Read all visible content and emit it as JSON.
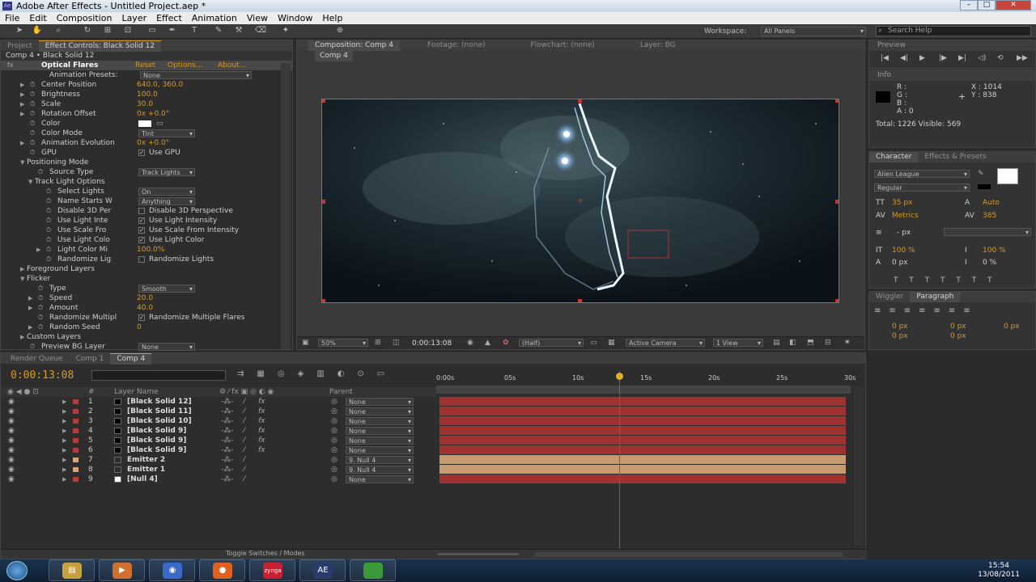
{
  "app": {
    "title": "Adobe After Effects - Untitled Project.aep *",
    "icon": "ae-icon"
  },
  "window_controls": {
    "minimize": "–",
    "maximize": "□",
    "close": "✕"
  },
  "menu": [
    "File",
    "Edit",
    "Composition",
    "Layer",
    "Effect",
    "Animation",
    "View",
    "Window",
    "Help"
  ],
  "toolbar": {
    "workspace_label": "Workspace:",
    "workspace_value": "All Panels",
    "search_placeholder": "Search Help"
  },
  "left_panel": {
    "tabs": [
      "Project",
      "Effect Controls: Black Solid 12"
    ],
    "breadcrumb": "Comp 4 • Black Solid 12",
    "effect_name": "Optical Flares",
    "reset": "Reset",
    "options": "Options...",
    "about": "About...",
    "props": [
      {
        "label": "Animation Presets:",
        "value": "None",
        "kind": "dd"
      },
      {
        "label": "Center Position",
        "value": "640.0, 360.0",
        "kind": "val"
      },
      {
        "label": "Brightness",
        "value": "100.0",
        "kind": "val"
      },
      {
        "label": "Scale",
        "value": "30.0",
        "kind": "val"
      },
      {
        "label": "Rotation Offset",
        "value": "0x +0.0°",
        "kind": "val"
      },
      {
        "label": "Color",
        "value": "",
        "kind": "color"
      },
      {
        "label": "Color Mode",
        "value": "Tint",
        "kind": "dd"
      },
      {
        "label": "Animation Evolution",
        "value": "0x +0.0°",
        "kind": "val"
      },
      {
        "label": "GPU",
        "value": "Use GPU",
        "kind": "chk"
      },
      {
        "label": "Positioning Mode",
        "value": "",
        "kind": "group"
      },
      {
        "label": "Source Type",
        "value": "Track Lights",
        "kind": "dd"
      },
      {
        "label": "Track Light Options",
        "value": "",
        "kind": "group"
      },
      {
        "label": "Select Lights",
        "value": "On",
        "kind": "dd"
      },
      {
        "label": "Name Starts W",
        "value": "Anything",
        "kind": "dd"
      },
      {
        "label": "Disable 3D Per",
        "value": "Disable 3D Perspective",
        "kind": "chk0"
      },
      {
        "label": "Use Light Inte",
        "value": "Use Light Intensity",
        "kind": "chk"
      },
      {
        "label": "Use Scale Fro",
        "value": "Use Scale From Intensity",
        "kind": "chk"
      },
      {
        "label": "Use Light Colo",
        "value": "Use Light Color",
        "kind": "chk"
      },
      {
        "label": "Light Color Mi",
        "value": "100.0%",
        "kind": "val"
      },
      {
        "label": "Randomize Lig",
        "value": "Randomize Lights",
        "kind": "chk0"
      },
      {
        "label": "Foreground Layers",
        "value": "",
        "kind": "group"
      },
      {
        "label": "Flicker",
        "value": "",
        "kind": "group"
      },
      {
        "label": "Type",
        "value": "Smooth",
        "kind": "dd"
      },
      {
        "label": "Speed",
        "value": "20.0",
        "kind": "val"
      },
      {
        "label": "Amount",
        "value": "40.0",
        "kind": "val"
      },
      {
        "label": "Randomize Multipl",
        "value": "Randomize Multiple Flares",
        "kind": "chk"
      },
      {
        "label": "Random Seed",
        "value": "0",
        "kind": "val"
      },
      {
        "label": "Custom Layers",
        "value": "",
        "kind": "group"
      },
      {
        "label": "Preview BG Layer",
        "value": "None",
        "kind": "dd"
      }
    ]
  },
  "comp_panel": {
    "tabs": [
      "Composition: Comp 4",
      "Footage: (none)",
      "Flowchart: (none)",
      "Layer: BG"
    ],
    "subtab": "Comp 4",
    "footer": {
      "zoom": "50%",
      "timecode": "0:00:13:08",
      "resolution": "(Half)",
      "camera": "Active Camera",
      "views": "1 View"
    }
  },
  "preview": {
    "title": "Preview",
    "buttons": [
      "first-frame-icon",
      "prev-frame-icon",
      "play-icon",
      "next-frame-icon",
      "last-frame-icon",
      "audio-icon",
      "loop-icon",
      "ram-preview-icon"
    ]
  },
  "info": {
    "title": "Info",
    "r": "R :",
    "g": "G :",
    "b": "B :",
    "a": "A : 0",
    "x": "X : 1014",
    "y": "Y : 838",
    "total": "Total: 1226  Visible: 569"
  },
  "character": {
    "tabs": [
      "Character",
      "Effects & Presets"
    ],
    "font": "Alien League",
    "style": "Regular",
    "size": "35 px",
    "leading": "Auto",
    "kerning": "Metrics",
    "tracking": "385",
    "stroke": "- px",
    "vscale": "100 %",
    "hscale": "100 %",
    "baseline": "0 px",
    "tsume": "0 %"
  },
  "paragraph": {
    "tabs": [
      "Wiggler",
      "Paragraph"
    ],
    "indent_left": "0 px",
    "indent_first": "0 px",
    "indent_right": "0 px",
    "space_before": "0 px",
    "space_after": "0 px"
  },
  "timeline": {
    "tabs": [
      "Render Queue",
      "Comp 1",
      "Comp 4"
    ],
    "timecode": "0:00:13:08",
    "col_layer_name": "Layer Name",
    "col_parent": "Parent",
    "ruler": [
      "0:00s",
      "05s",
      "10s",
      "15s",
      "20s",
      "25s",
      "30s"
    ],
    "toggle": "Toggle Switches / Modes",
    "layers": [
      {
        "num": "1",
        "name": "[Black Solid 12]",
        "parent": "None",
        "color": "#b43c3c",
        "bar": "#a03232",
        "fx": true
      },
      {
        "num": "2",
        "name": "[Black Solid 11]",
        "parent": "None",
        "color": "#b43c3c",
        "bar": "#a03232",
        "fx": true
      },
      {
        "num": "3",
        "name": "[Black Solid 10]",
        "parent": "None",
        "color": "#b43c3c",
        "bar": "#a03232",
        "fx": true
      },
      {
        "num": "4",
        "name": "[Black Solid 9]",
        "parent": "None",
        "color": "#b43c3c",
        "bar": "#a03232",
        "fx": true
      },
      {
        "num": "5",
        "name": "[Black Solid 9]",
        "parent": "None",
        "color": "#b43c3c",
        "bar": "#a03232",
        "fx": true
      },
      {
        "num": "6",
        "name": "[Black Solid 9]",
        "parent": "None",
        "color": "#b43c3c",
        "bar": "#a03232",
        "fx": true
      },
      {
        "num": "7",
        "name": "Emitter 2",
        "parent": "9. Null 4",
        "color": "#d9a27a",
        "bar": "#c99a70",
        "fx": false
      },
      {
        "num": "8",
        "name": "Emitter 1",
        "parent": "9. Null 4",
        "color": "#d9a27a",
        "bar": "#c99a70",
        "fx": false
      },
      {
        "num": "9",
        "name": "[Null 4]",
        "parent": "None",
        "color": "#b43c3c",
        "bar": "#a03232",
        "fx": false
      }
    ]
  },
  "taskbar": {
    "clock_time": "15:54",
    "clock_date": "13/08/2011",
    "apps": [
      "explorer-icon",
      "media-player-icon",
      "browser-icon",
      "firefox-icon",
      "zynga-icon",
      "after-effects-icon",
      "app-icon"
    ],
    "ae_label": "AE",
    "zynga_label": "zynga"
  }
}
